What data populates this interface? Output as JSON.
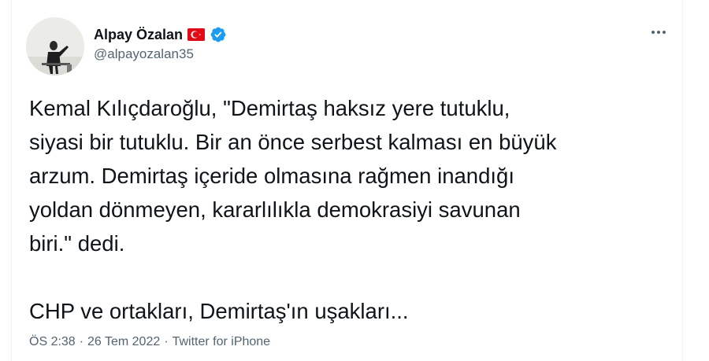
{
  "author": {
    "display_name": "Alpay Özalan",
    "handle": "@alpayozalan35",
    "flag_icon": "turkey-flag-icon",
    "verified_icon": "verified-badge-icon",
    "avatar_icon": "profile-avatar"
  },
  "menu": {
    "more_icon": "more-options-icon"
  },
  "tweet": {
    "text": "Kemal Kılıçdaroğlu, \"Demirtaş haksız yere tutuklu,\nsiyasi bir tutuklu. Bir an önce serbest kalması en büyük\narzum. Demirtaş içeride olmasına rağmen inandığı\nyoldan dönmeyen, kararlılıkla demokrasiyi savunan\nbiri.\" dedi.\n\nCHP ve ortakları, Demirtaş'ın uşakları..."
  },
  "meta": {
    "time": "ÖS 2:38",
    "date": "26 Tem 2022",
    "source": "Twitter for iPhone",
    "separator": "·"
  },
  "colors": {
    "text": "#0f1419",
    "secondary": "#536471",
    "verified": "#1d9bf0",
    "flag_red": "#e30a17"
  }
}
